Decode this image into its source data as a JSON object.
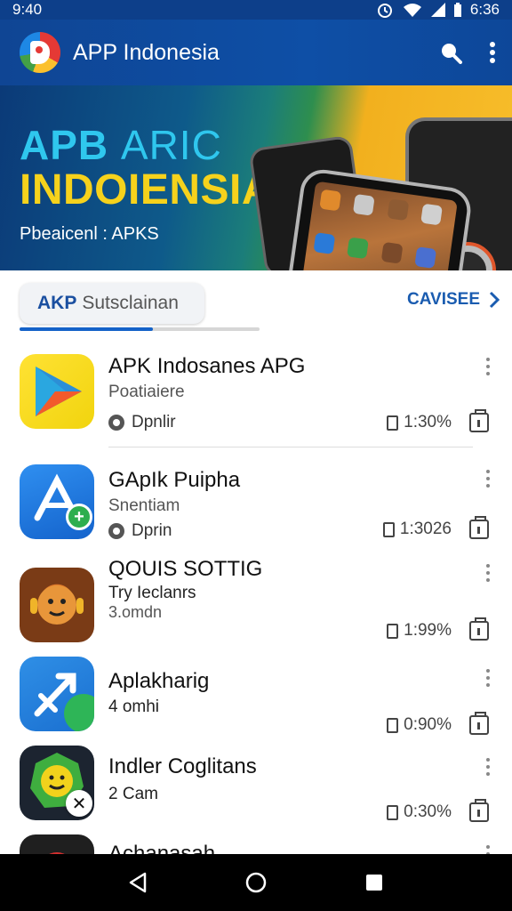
{
  "status_bar": {
    "time": "9:40",
    "right_time": "6:36"
  },
  "app_bar": {
    "title": "APP Indonesia",
    "search_icon": "search-icon",
    "menu_icon": "more-vert-icon"
  },
  "banner": {
    "line1_a": "APB",
    "line1_b": "ARIC",
    "line2": "INDOIENSIA",
    "line3": "Pbeaicenl : APKS"
  },
  "tabs": {
    "pill_bold": "AKP",
    "pill_rest": "Sutsclainan",
    "see_all": "CAVISEE"
  },
  "apps": [
    {
      "name": "APK Indosanes APG",
      "sub": "Poatiaiere",
      "author": "Dpnlir",
      "size": "1:30%"
    },
    {
      "name": "GApIk Puipha",
      "sub": "Snentiam",
      "author": "Dprin",
      "size": "1:3026"
    },
    {
      "name": "QOUIS SOTTIG",
      "sub": "Try Ieclanrs",
      "sub2": "3.omdn",
      "size": "1:99%"
    },
    {
      "name": "Aplakharig",
      "sub": "4 omhi",
      "size": "0:90%"
    },
    {
      "name": "Indler Coglitans",
      "sub": "2 Cam",
      "size": "0:30%"
    },
    {
      "name": "Achanasah"
    }
  ],
  "colors": {
    "app_bar": "#0e4a9e",
    "accent": "#1462c8",
    "banner_yellow": "#f6d21c",
    "banner_cyan": "#2fc7ee"
  }
}
